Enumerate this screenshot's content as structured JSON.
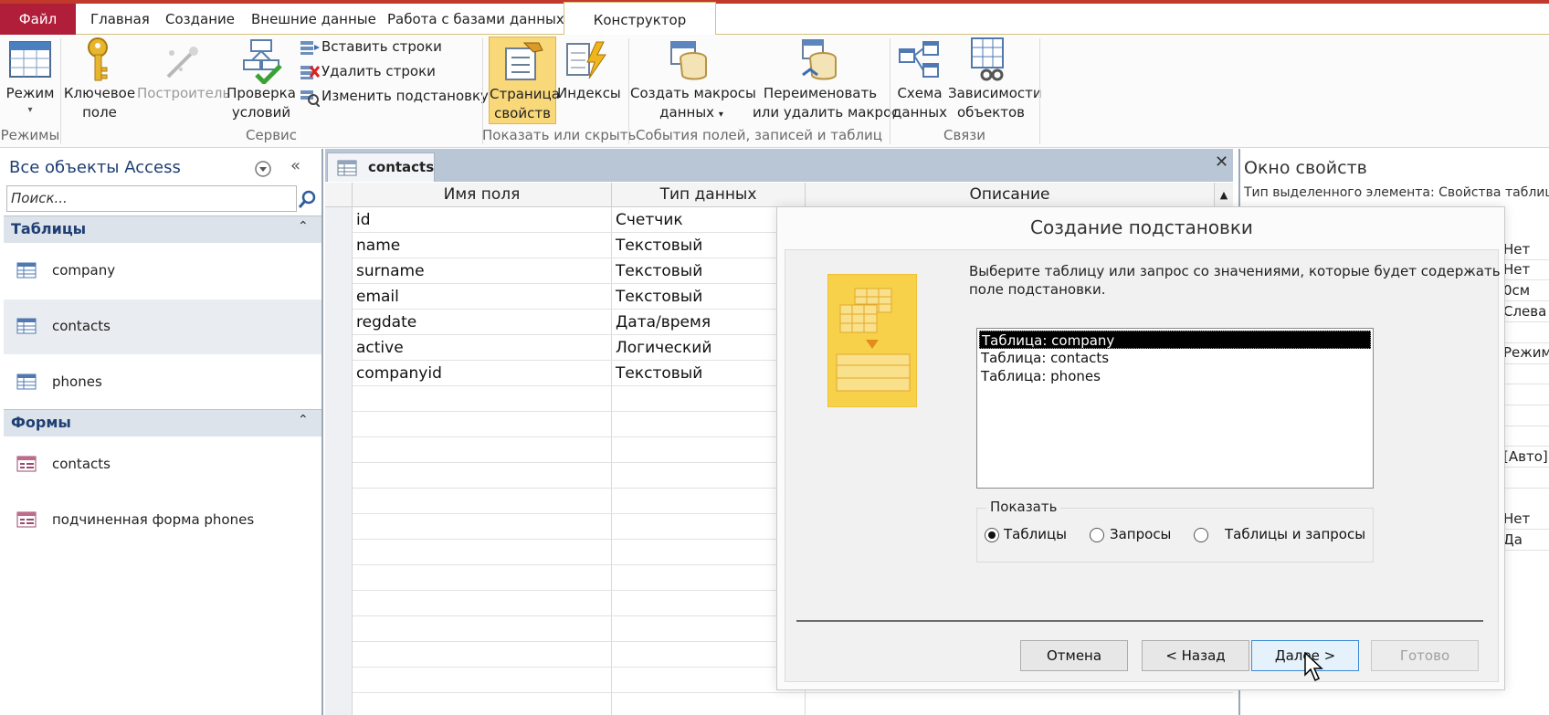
{
  "ribbon_tabs": {
    "file": "Файл",
    "home": "Главная",
    "create": "Создание",
    "external": "Внешние данные",
    "dbtools": "Работа с базами данных",
    "design": "Конструктор"
  },
  "ribbon": {
    "view": "Режим",
    "primary_key": [
      "Ключевое",
      "поле"
    ],
    "builder": "Построитель",
    "test_rules": [
      "Проверка",
      "условий"
    ],
    "insert_rows": "Вставить строки",
    "delete_rows": "Удалить строки",
    "modify_lookups": "Изменить подстановку",
    "property_sheet": [
      "Страница",
      "свойств"
    ],
    "indexes": "Индексы",
    "create_macros": [
      "Создать макросы",
      "данных"
    ],
    "rename_macro": [
      "Переименовать",
      "или удалить макрос"
    ],
    "relationships": [
      "Схема",
      "данных"
    ],
    "dependencies": [
      "Зависимости",
      "объектов"
    ],
    "groups": {
      "views": "Режимы",
      "tools": "Сервис",
      "show_hide": "Показать или скрыть",
      "field_events": "События полей, записей и таблиц",
      "relationships": "Связи"
    }
  },
  "nav": {
    "title": "Все объекты Access",
    "search_placeholder": "Поиск...",
    "tables_header": "Таблицы",
    "tables": [
      "company",
      "contacts",
      "phones"
    ],
    "forms_header": "Формы",
    "forms": [
      "contacts",
      "подчиненная форма phones"
    ]
  },
  "doc": {
    "tab": "contacts",
    "col_field": "Имя поля",
    "col_type": "Тип данных",
    "col_desc": "Описание",
    "rows": [
      {
        "field": "id",
        "type": "Счетчик"
      },
      {
        "field": "name",
        "type": "Текстовый"
      },
      {
        "field": "surname",
        "type": "Текстовый"
      },
      {
        "field": "email",
        "type": "Текстовый"
      },
      {
        "field": "regdate",
        "type": "Дата/время"
      },
      {
        "field": "active",
        "type": "Логический"
      },
      {
        "field": "companyid",
        "type": "Текстовый"
      }
    ]
  },
  "props": {
    "title": "Окно свойств",
    "selection_type": "Тип выделенного элемента: Свойства таблицы",
    "values": [
      "Нет",
      "Нет",
      "0см",
      "Слева",
      "Режим",
      "[Авто]",
      "Нет",
      "Да"
    ]
  },
  "dialog": {
    "title": "Создание подстановки",
    "instruction_line1": "Выберите таблицу или запрос со значениями, которые будет содержать",
    "instruction_line2": "поле подстановки.",
    "list": [
      "Таблица: company",
      "Таблица: contacts",
      "Таблица: phones"
    ],
    "selected_index": 0,
    "show_label": "Показать",
    "radio_tables": "Таблицы",
    "radio_queries": "Запросы",
    "radio_both": "Таблицы и запросы",
    "btn_cancel": "Отмена",
    "btn_back": "< Назад",
    "btn_next": "Далее >",
    "btn_finish": "Готово"
  }
}
